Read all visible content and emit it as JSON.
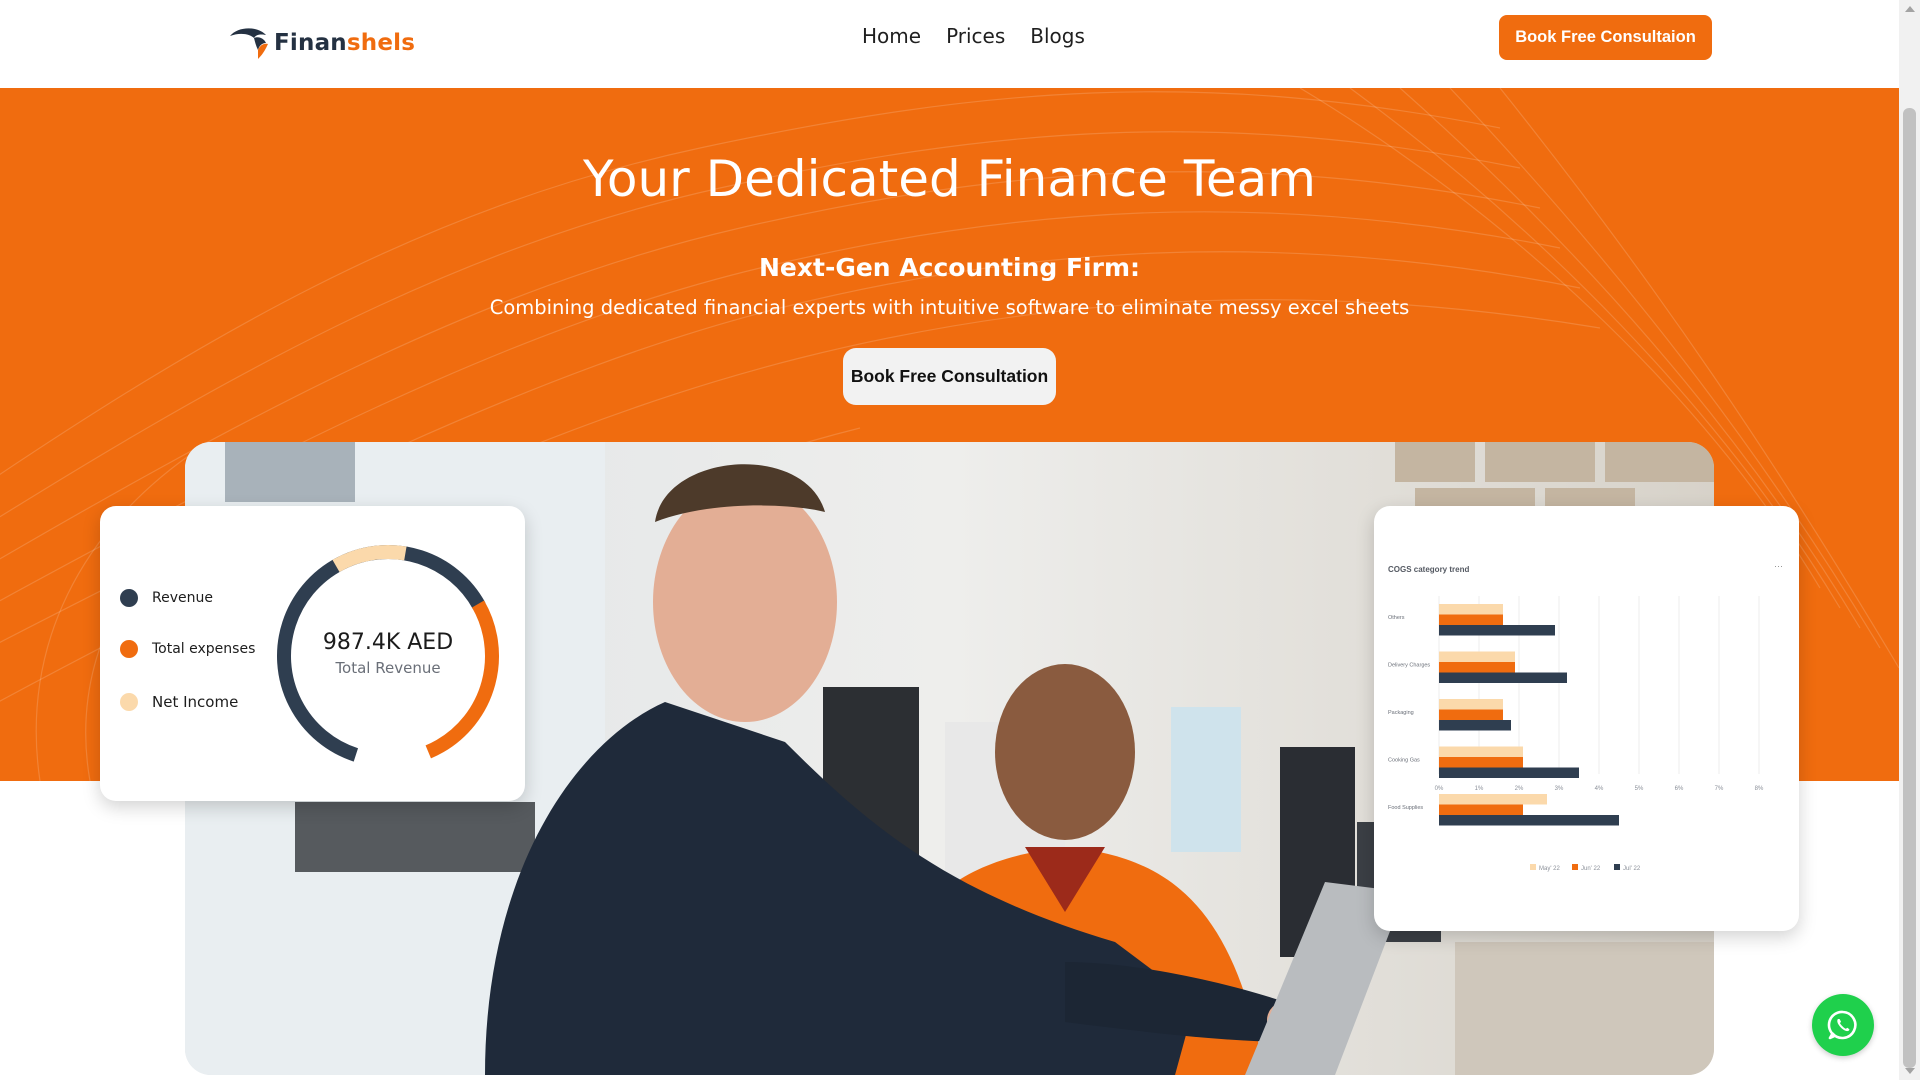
{
  "header": {
    "logo": {
      "part1": "Finan",
      "part2": "shels"
    },
    "nav": [
      {
        "label": "Home"
      },
      {
        "label": "Prices"
      },
      {
        "label": "Blogs"
      }
    ],
    "cta_label": "Book Free Consultaion"
  },
  "hero": {
    "title": "Your Dedicated Finance Team",
    "subtitle": "Next-Gen Accounting Firm:",
    "description": "Combining dedicated financial experts with intuitive software to eliminate messy excel sheets",
    "cta_label": "Book Free Consultation"
  },
  "revenue_card": {
    "legend": [
      {
        "label": "Revenue",
        "color": "#2f3e50"
      },
      {
        "label": "Total expenses",
        "color": "#f06c0f"
      },
      {
        "label": "Net Income",
        "color": "#fbd9ab"
      }
    ],
    "value": "987.4K AED",
    "value_label": "Total Revenue",
    "chart_data": {
      "type": "pie",
      "labels": [
        "Revenue",
        "Total expenses",
        "Net Income"
      ],
      "values": [
        62,
        27,
        11
      ],
      "colors": [
        "#2f3e50",
        "#f06c0f",
        "#fbd9ab"
      ]
    }
  },
  "cogs_card": {
    "title": "COGS category trend",
    "menu": "···",
    "chart_data": {
      "type": "bar",
      "orientation": "horizontal",
      "title": "COGS category trend",
      "categories": [
        "Others",
        "Delivery Charges",
        "Packaging",
        "Cooking Gas",
        "Food Supplies"
      ],
      "series": [
        {
          "name": "May' 22",
          "color": "#fbd9ab",
          "values": [
            1.6,
            1.9,
            1.6,
            2.1,
            2.7
          ]
        },
        {
          "name": "Jun' 22",
          "color": "#f06c0f",
          "values": [
            1.6,
            1.9,
            1.6,
            2.1,
            2.1
          ]
        },
        {
          "name": "Jul' 22",
          "color": "#2f3e50",
          "values": [
            2.9,
            3.2,
            1.8,
            3.5,
            4.5
          ]
        }
      ],
      "x_ticks": [
        "0%",
        "1%",
        "2%",
        "3%",
        "4%",
        "5%",
        "6%",
        "7%",
        "8%"
      ],
      "xlim": [
        0,
        8
      ]
    }
  },
  "photo": {
    "icon": "photo-of-two-men-at-laptop"
  },
  "whatsapp": {
    "icon": "whatsapp-icon",
    "color": "#1fd04c"
  },
  "colors": {
    "brand_orange": "#f06c0f",
    "brand_navy": "#243142"
  }
}
